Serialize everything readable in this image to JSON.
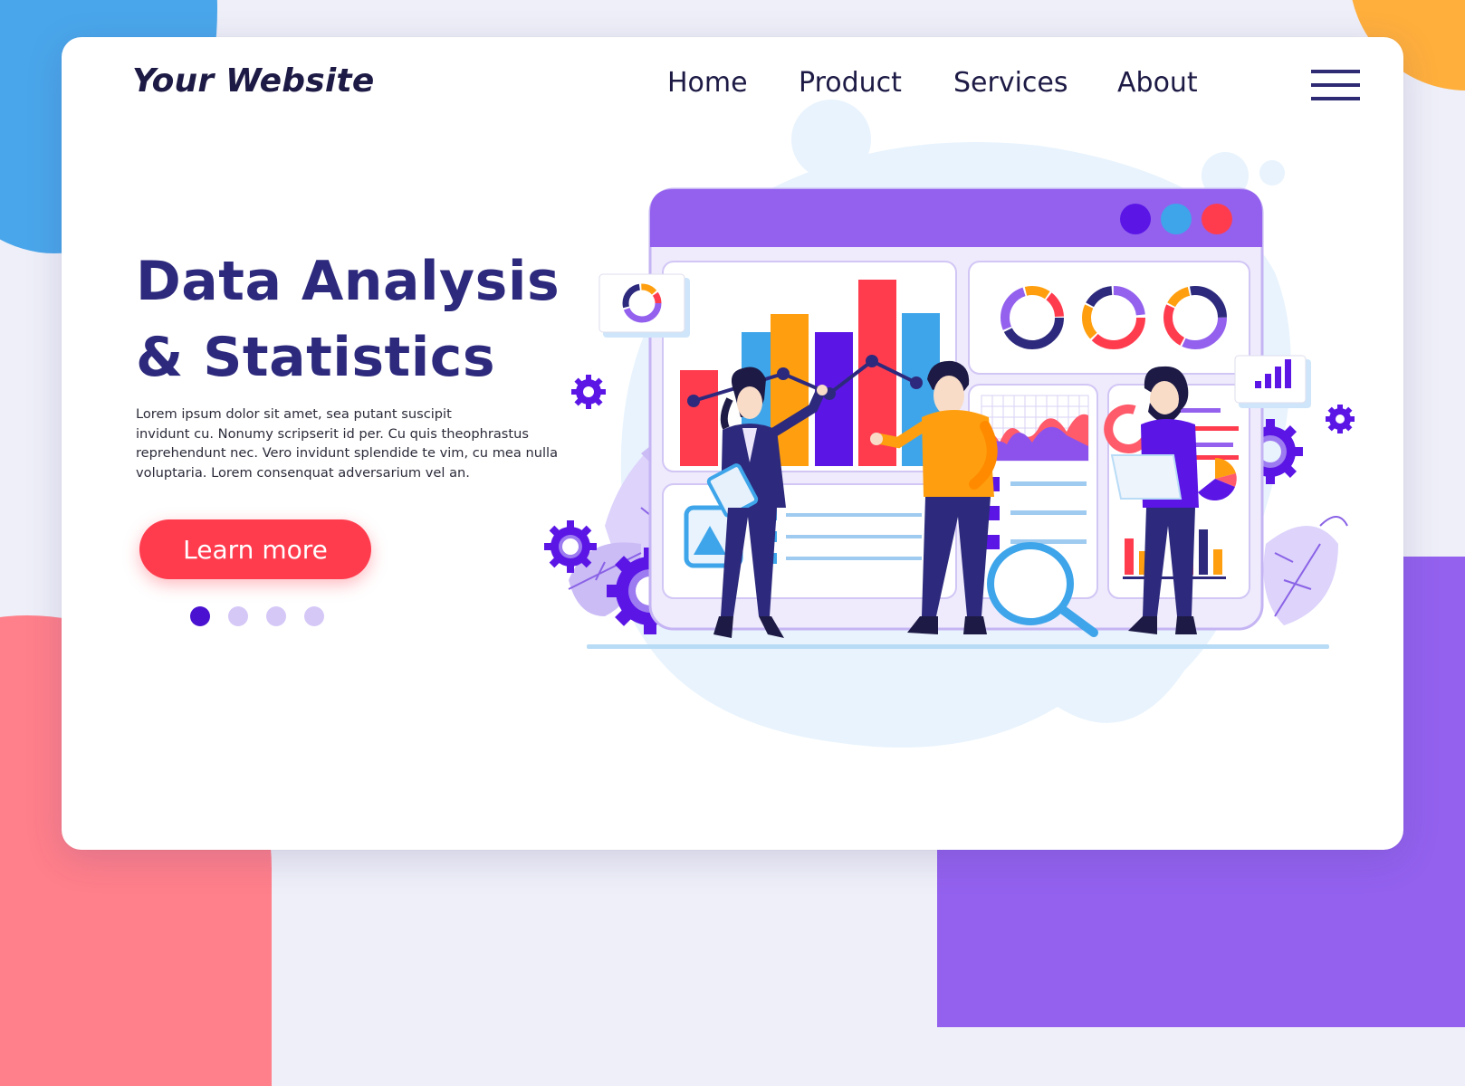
{
  "site": {
    "brand": "Your Website"
  },
  "nav": {
    "items": [
      {
        "label": "Home"
      },
      {
        "label": "Product"
      },
      {
        "label": "Services"
      },
      {
        "label": "About"
      }
    ],
    "menu_icon": "hamburger-menu-icon"
  },
  "hero": {
    "title_line1": "Data Analysis",
    "title_line2": "& Statistics",
    "body_lines": [
      "Lorem ipsum dolor sit amet, sea putant suscipit",
      "invidunt cu. Nonumy scripserit id per. Cu quis theophrastus",
      "reprehendunt nec. Vero invidunt splendide te vim, cu mea nulla",
      "voluptaria. Lorem consenquat adversarium vel an."
    ],
    "cta_label": "Learn more"
  },
  "pagination": {
    "total": 4,
    "active_index": 0
  },
  "colors": {
    "brand_dark": "#1d1a45",
    "title": "#2d2a7d",
    "cta": "#ff3c4e",
    "dot_active": "#4a12d0",
    "dot_inactive": "#d5c8f7",
    "window_bar": "#9361ee",
    "window_dot_1": "#5b16e6",
    "window_dot_2": "#3ea5ea",
    "window_dot_3": "#ff3c4e"
  },
  "illustration": {
    "subject": "data-analysis-team",
    "elements": [
      "browser-window",
      "bar-chart",
      "line-chart",
      "donut-charts",
      "area-chart",
      "checklist",
      "image-placeholder",
      "pie-chart",
      "mini-bar-chart",
      "magnifier",
      "gears",
      "leaves",
      "three-people"
    ]
  }
}
